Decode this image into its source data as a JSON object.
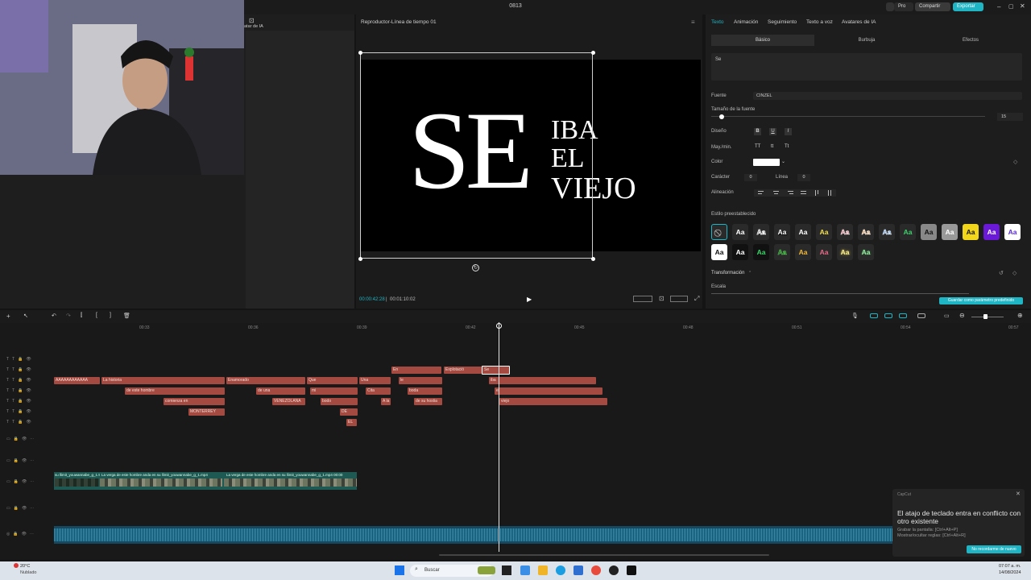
{
  "window": {
    "title": "0813"
  },
  "topbar": {
    "pro": "Pro",
    "share": "Compartir",
    "export": "Exportar"
  },
  "left": {
    "ai_avatar_label": "atar de IA"
  },
  "player": {
    "title": "Reproductor-Línea de tiempo 01",
    "current_time": "00:00:42:28",
    "total_time": "00:01:10:02",
    "canvas_text": {
      "big": "SE",
      "line1": "IBA",
      "line2": "EL",
      "line3": "VIEJO"
    }
  },
  "props": {
    "tabs": [
      "Texto",
      "Animación",
      "Seguimiento",
      "Texto a voz",
      "Avatares de IA"
    ],
    "subtabs": [
      "Básico",
      "Burbuja",
      "Efectos"
    ],
    "text_value": "Se",
    "font_label": "Fuente",
    "font_value": "CINZEL",
    "size_label": "Tamaño de la fuente",
    "size_value": "15",
    "design_label": "Diseño",
    "case_label": "May./min.",
    "color_label": "Color",
    "char_label": "Carácter",
    "char_value": "0",
    "line_label": "Línea",
    "line_value": "0",
    "align_label": "Alineación",
    "preset_label": "Estilo preestablecido",
    "transform_label": "Transformación",
    "scale_label": "Escala",
    "save_default": "Guardar como parámetro predefinido",
    "preset_glyph": "Aa"
  },
  "timeline": {
    "ticks": [
      "00:33",
      "00:36",
      "00:39",
      "00:42",
      "00:45",
      "00:48",
      "00:51",
      "00:54",
      "00:57"
    ],
    "clips_row1": [
      "En",
      "Explotació",
      "Se"
    ],
    "clips_row2": [
      "AAAAAAAAAAAA",
      "La historia",
      "Enamorado",
      "Que",
      "Una",
      "le",
      "iba"
    ],
    "clips_row3": [
      "de este hombre",
      "de una",
      "mi",
      "Cita",
      "boda",
      "el"
    ],
    "clips_row4": [
      "comienza en",
      "VENEZOLANA",
      "bodo",
      "A la",
      "de su hostia",
      "viejo"
    ],
    "clips_row5": [
      "MONTERREY",
      "DE"
    ],
    "clips_row6": [
      "EL"
    ],
    "video_labels": [
      "su llimit_youwannabe_g_1.9",
      "La verga de este hombre anda en su llimit_youwannabe_g_1.mp4",
      "La verga de este hombre anda en su llimit_youwannabe_g_1.mp4  00:00"
    ]
  },
  "toast": {
    "app": "CapCut",
    "title": "El atajo de teclado entra en conflicto con otro existente",
    "line1": "Grabar la pantalla: [Ctrl+Alt+P]",
    "line2": "Mostrar/ocultar reglas: [Ctrl+Alt+R]",
    "button": "No recordarme de nuevo"
  },
  "taskbar": {
    "weather_temp": "20°C",
    "weather_desc": "Nublado",
    "search": "Buscar",
    "time": "07:07 a. m.",
    "date": "14/08/2024"
  },
  "colors": {
    "accent": "#1fb5c4",
    "clip": "#a44a40",
    "video": "#1e5a53",
    "audio": "#16485f"
  }
}
